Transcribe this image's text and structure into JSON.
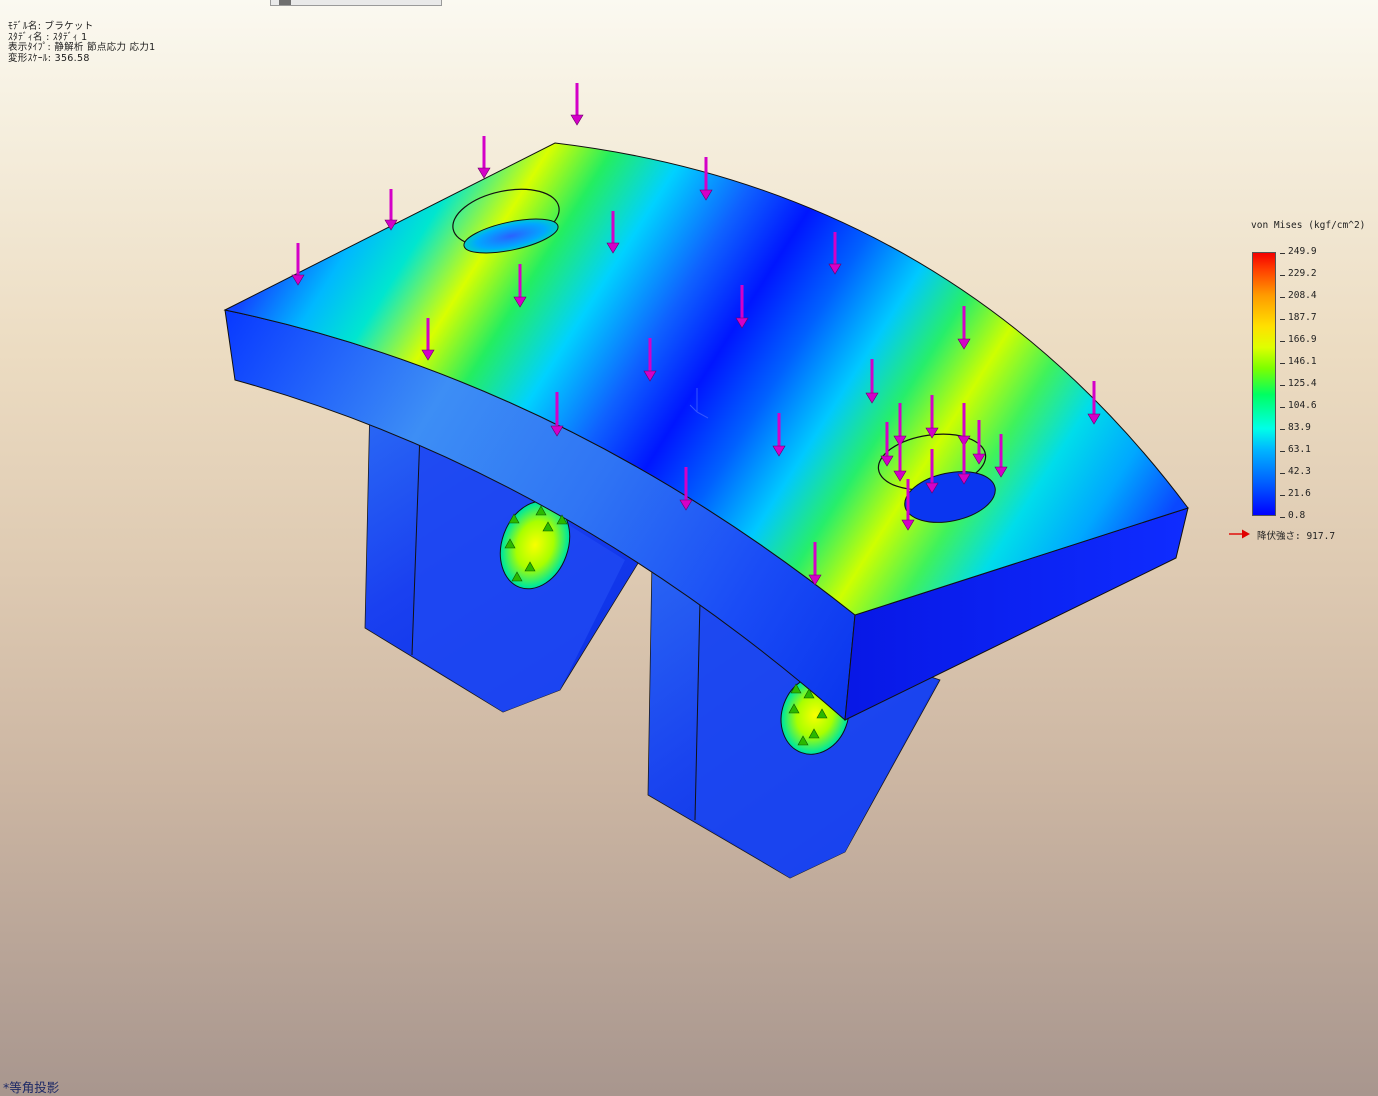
{
  "window": {
    "tab_label": ""
  },
  "study_info": {
    "model_name": "ﾓﾃﾞﾙ名: ブラケット",
    "study_name": "ｽﾀﾃﾞｨ名 : ｽﾀﾃﾞｨ 1",
    "plot_type": "表示ﾀｲﾌﾟ: 静解析 節点応力 応力1",
    "deformation_scale": "変形ｽｹｰﾙ: 356.58"
  },
  "legend": {
    "title": "von Mises (kgf/cm^2)",
    "labels": [
      "249.9",
      "229.2",
      "208.4",
      "187.7",
      "166.9",
      "146.1",
      "125.4",
      "104.6",
      "83.9",
      "63.1",
      "42.3",
      "21.6",
      "0.8"
    ],
    "yield_strength": "降伏強さ: 917.7",
    "colors": {
      "max": "#f40000",
      "high": "#ff9a00",
      "mid_high": "#dfff00",
      "mid": "#00ff62",
      "mid_low": "#00ffe8",
      "low": "#005cff",
      "min": "#0000ff",
      "yield_arrow": "#e00000"
    }
  },
  "model": {
    "name": "ブラケット",
    "load_arrow_color": "#d400c8",
    "fixture_color": "#2ab800"
  },
  "view": {
    "orientation_label": "*等角投影"
  }
}
